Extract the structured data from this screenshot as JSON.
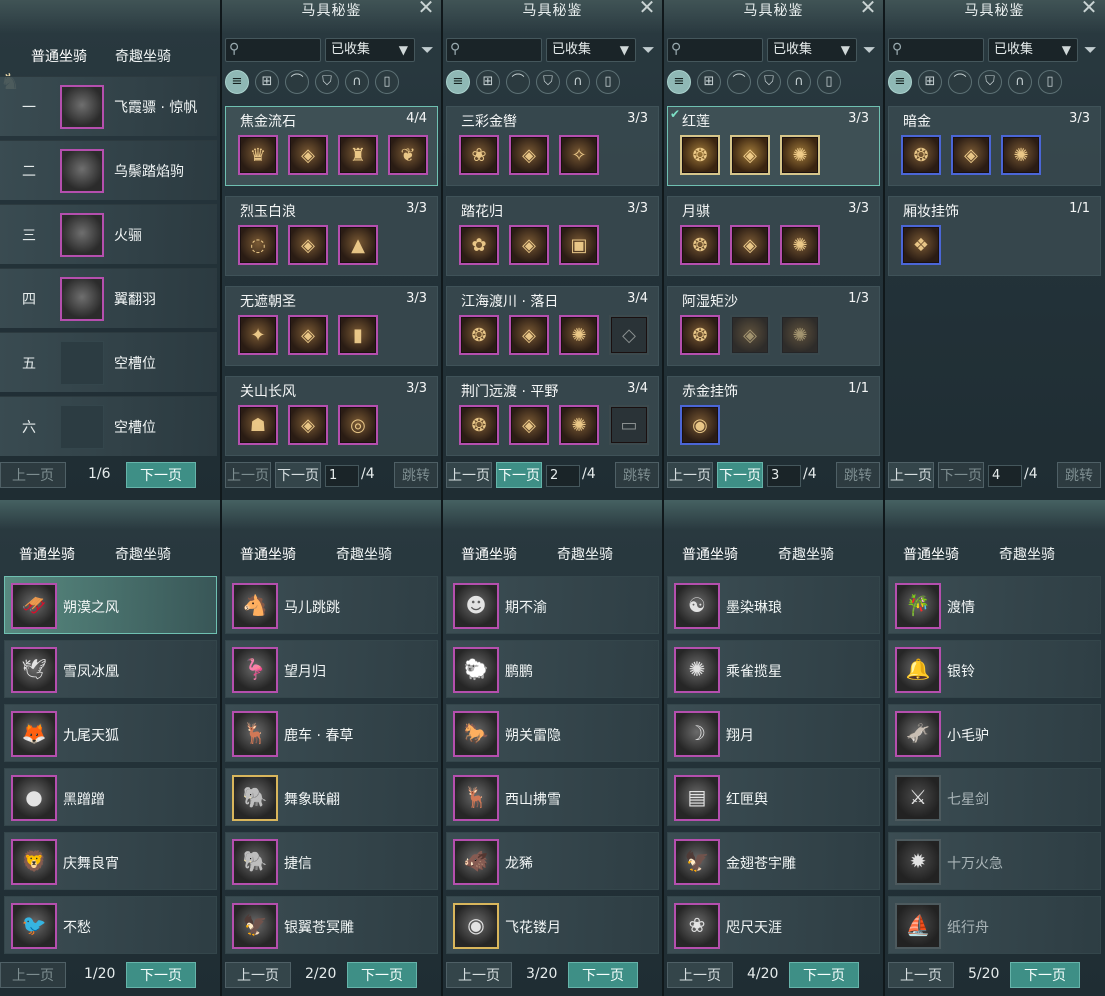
{
  "colors": {
    "accent": "#3e8f86",
    "rare_border": "#b54fae",
    "gold_border": "#d6c58a",
    "blue_border": "#4b66d6",
    "selected_border": "#6fc0b1"
  },
  "common": {
    "tab_normal": "普通坐骑",
    "tab_fun": "奇趣坐骑",
    "codex_title": "马具秘鉴",
    "close_icon": "✕",
    "filter_value": "已收集",
    "prev": "上一页",
    "next": "下一页",
    "jump": "跳转",
    "page_total": "/4"
  },
  "mount_slots": {
    "slots": [
      {
        "num": "一",
        "name": "飞霞骠 · 惊帆",
        "empty": false
      },
      {
        "num": "二",
        "name": "乌鬃踏焰驹",
        "empty": false
      },
      {
        "num": "三",
        "name": "火骊",
        "empty": false
      },
      {
        "num": "四",
        "name": "翼翻羽",
        "empty": false
      },
      {
        "num": "五",
        "name": "空槽位",
        "empty": true
      },
      {
        "num": "六",
        "name": "空槽位",
        "empty": true
      }
    ],
    "page": "1/6"
  },
  "codex_pages": [
    {
      "page_input": "1",
      "sets": [
        {
          "name": "焦金流石",
          "count": "4/4",
          "items": 4,
          "sel": true
        },
        {
          "name": "烈玉白浪",
          "count": "3/3",
          "items": 3
        },
        {
          "name": "无遮朝圣",
          "count": "3/3",
          "items": 3
        },
        {
          "name": "关山长风",
          "count": "3/3",
          "items": 3
        }
      ]
    },
    {
      "page_input": "2",
      "sets": [
        {
          "name": "三彩金辔",
          "count": "3/3",
          "items": 3
        },
        {
          "name": "踏花归",
          "count": "3/3",
          "items": 3
        },
        {
          "name": "江海渡川 · 落日",
          "count": "3/4",
          "items": 4
        },
        {
          "name": "荆门远渡 · 平野",
          "count": "3/4",
          "items": 4
        }
      ]
    },
    {
      "page_input": "3",
      "sets": [
        {
          "name": "红莲",
          "count": "3/3",
          "items": 3,
          "sel": true,
          "gold": true
        },
        {
          "name": "月骐",
          "count": "3/3",
          "items": 3
        },
        {
          "name": "阿湿矩沙",
          "count": "1/3",
          "items": 3
        },
        {
          "name": "赤金挂饰",
          "count": "1/1",
          "items": 1,
          "blue": true
        }
      ]
    },
    {
      "page_input": "4",
      "sets": [
        {
          "name": "暗金",
          "count": "3/3",
          "items": 3,
          "blue": true
        },
        {
          "name": "厢妆挂饰",
          "count": "1/1",
          "items": 1,
          "blue": true
        }
      ]
    }
  ],
  "fun_pages": [
    {
      "page": "1/20",
      "items": [
        "朔漠之风",
        "雪凤冰凰",
        "九尾天狐",
        "黑蹭蹭",
        "庆舞良宵",
        "不愁"
      ]
    },
    {
      "page": "2/20",
      "items": [
        "马儿跳跳",
        "望月归",
        "鹿车 · 春草",
        "舞象联翩",
        "捷信",
        "银翼苍冥雕"
      ]
    },
    {
      "page": "3/20",
      "items": [
        "期不渝",
        "鹏鹏",
        "朔关雷隐",
        "西山拂雪",
        "龙豨",
        "飞花镂月"
      ]
    },
    {
      "page": "4/20",
      "items": [
        "墨染琳琅",
        "乘雀揽星",
        "翔月",
        "红匣舆",
        "金翅苍宇雕",
        "咫尺天涯"
      ]
    },
    {
      "page": "5/20",
      "items": [
        "渡情",
        "银铃",
        "小毛驴",
        "七星剑",
        "十万火急",
        "纸行舟"
      ]
    }
  ]
}
